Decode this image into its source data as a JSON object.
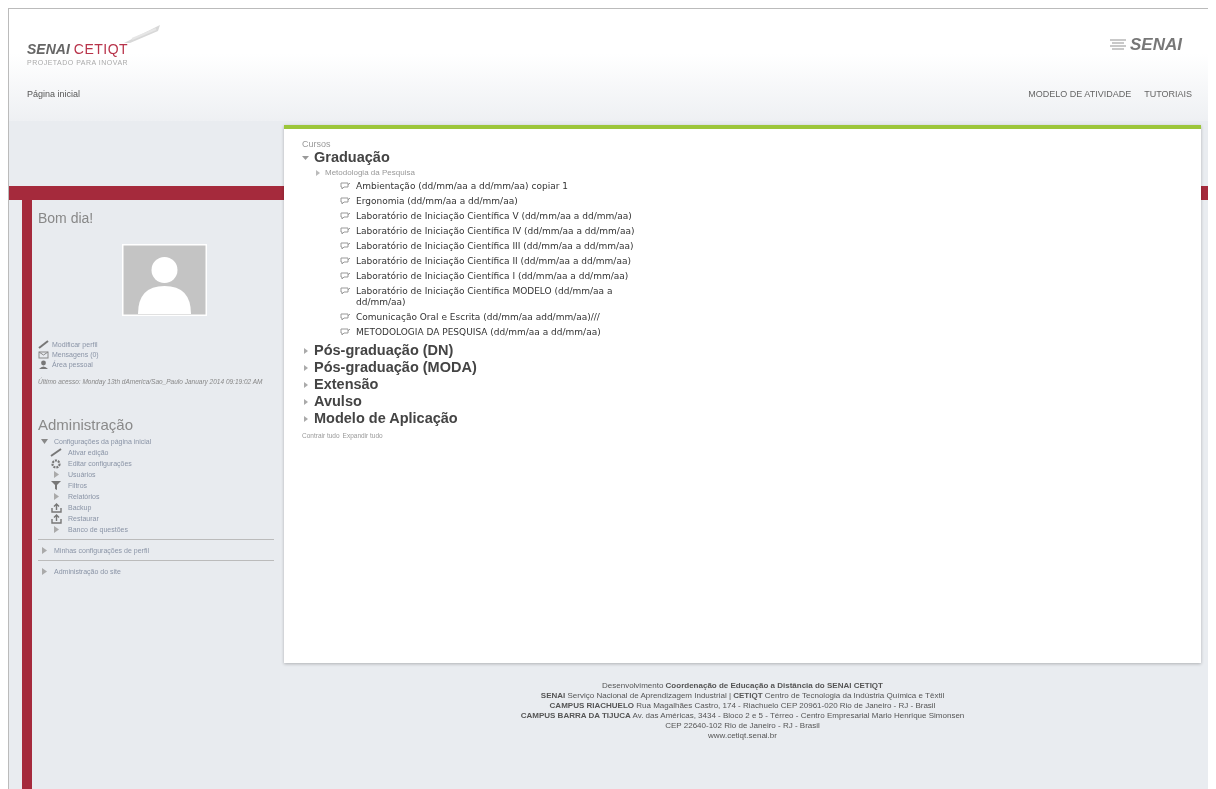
{
  "header": {
    "logo": {
      "brand": "SENAI",
      "sub": "CETIQT",
      "tagline": "PROJETADO PARA INOVAR"
    },
    "partner_logo": "SENAI",
    "breadcrumb": "Página inicial",
    "nav": [
      "MODELO DE ATIVIDADE",
      "TUTORIAIS"
    ]
  },
  "user_block": {
    "title": "Bom dia!",
    "links": [
      {
        "label": "Modificar perfil",
        "kind": "pencil"
      },
      {
        "label": "Mensagens (0)",
        "kind": "mail"
      },
      {
        "label": "Área pessoal",
        "kind": "user"
      }
    ],
    "last_access": "Último acesso: Monday 13th dAmerica/Sao_Paulo January 2014 09:19:02 AM"
  },
  "administration": {
    "title": "Administração",
    "items": [
      {
        "label": "Configurações da página inicial",
        "kind": "folder",
        "expanded": true,
        "children": [
          {
            "label": "Ativar edição",
            "kind": "pencil"
          },
          {
            "label": "Editar configurações",
            "kind": "gear"
          },
          {
            "label": "Usuários",
            "kind": "folder",
            "expanded": false
          },
          {
            "label": "Filtros",
            "kind": "filter"
          },
          {
            "label": "Relatórios",
            "kind": "folder",
            "expanded": false
          },
          {
            "label": "Backup",
            "kind": "upload"
          },
          {
            "label": "Restaurar",
            "kind": "upload"
          },
          {
            "label": "Banco de questões",
            "kind": "folder",
            "expanded": false
          }
        ]
      },
      {
        "label": "Minhas configurações de perfil",
        "kind": "folder",
        "expanded": false
      },
      {
        "label": "Administração do site",
        "kind": "folder",
        "expanded": false
      }
    ]
  },
  "courses": {
    "title": "Cursos",
    "categories": [
      {
        "name": "Graduação",
        "expanded": true,
        "children": [
          {
            "name": "Metodologia da Pesquisa",
            "courses": [
              "Ambientação (dd/mm/aa a dd/mm/aa) copiar 1",
              "Ergonomia (dd/mm/aa a dd/mm/aa)",
              "Laboratório de Iniciação Científica V (dd/mm/aa a dd/mm/aa)",
              "Laboratório de Iniciação Científica IV (dd/mm/aa a dd/mm/aa)",
              "Laboratório de Iniciação Científica III (dd/mm/aa a dd/mm/aa)",
              "Laboratório de Iniciação Científica II (dd/mm/aa a dd/mm/aa)",
              "Laboratório de Iniciação Científica I (dd/mm/aa a dd/mm/aa)",
              "Laboratório de Iniciação Científica MODELO (dd/mm/aa a dd/mm/aa)",
              "Comunicação Oral e Escrita (dd/mm/aa add/mm/aa)///",
              "METODOLOGIA DA PESQUISA (dd/mm/aa a dd/mm/aa)"
            ]
          }
        ]
      },
      {
        "name": "Pós-graduação (DN)",
        "expanded": false
      },
      {
        "name": "Pós-graduação (MODA)",
        "expanded": false
      },
      {
        "name": "Extensão",
        "expanded": false
      },
      {
        "name": "Avulso",
        "expanded": false
      },
      {
        "name": "Modelo de Aplicação",
        "expanded": false
      }
    ],
    "controls": [
      "Contrair tudo",
      "Expandir tudo"
    ]
  },
  "footer": [
    "Desenvolvimento **Coordenação de Educação a Distância do SENAI CETIQT**",
    "**SENAI** Serviço Nacional de Aprendizagem Industrial | **CETIQT** Centro de Tecnologia da Indústria Química e Têxtil",
    "**CAMPUS RIACHUELO** Rua Magalhães Castro, 174 - Riachuelo CEP 20961-020 Rio de Janeiro - RJ - Brasil",
    "**CAMPUS BARRA DA TIJUCA** Av. das Américas, 3434 - Bloco 2 e 5 - Térreo - Centro Empresarial Mario Henrique Simonsen",
    "CEP 22640-102 Rio de Janeiro - RJ - Brasil",
    "www.cetiqt.senai.br"
  ]
}
